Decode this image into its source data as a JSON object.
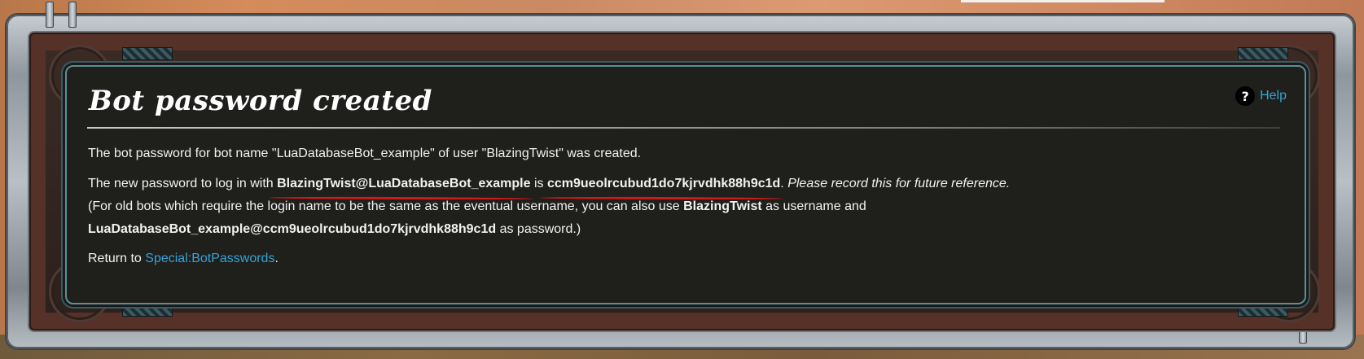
{
  "dialog": {
    "title": "Bot password created",
    "help_label": "Help",
    "help_icon": "question-circle-icon"
  },
  "message": {
    "line1": "The bot password for bot name \"LuaDatabaseBot_example\" of user \"BlazingTwist\" was created.",
    "line2_prefix": "The new password to log in with ",
    "login_name": "BlazingTwist@LuaDatabaseBot_example",
    "line2_is": " is ",
    "password": "ccm9ueolrcubud1do7kjrvdhk88h9c1d",
    "line2_period": ".",
    "line2_note": " Please record this for future reference.",
    "line3_prefix": "(For old bots which require the login name to be the same as the eventual username, you can also use ",
    "username": "BlazingTwist",
    "line3_mid": " as username and",
    "legacy_password": "LuaDatabaseBot_example@ccm9ueolrcubud1do7kjrvdhk88h9c1d",
    "line4_suffix": " as password.)",
    "return_prefix": "Return to ",
    "return_link": "Special:BotPasswords",
    "return_suffix": "."
  },
  "colors": {
    "panel_bg": "#1f1f1c",
    "link": "#36a3d6",
    "annotation_underline": "#cc1b1b"
  }
}
